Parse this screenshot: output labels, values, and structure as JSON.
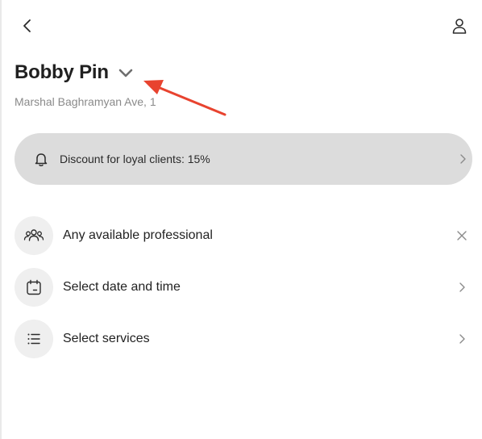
{
  "header": {
    "back_icon": "chevron-left-icon",
    "profile_icon": "user-icon"
  },
  "salon": {
    "name": "Bobby Pin",
    "address": "Marshal Baghramyan Ave, 1",
    "switch_icon": "chevron-down-icon"
  },
  "banner": {
    "icon": "bell-icon",
    "text": "Discount for loyal clients: 15%",
    "trail_icon": "chevron-right-icon"
  },
  "options": [
    {
      "label": "Any available professional",
      "icon": "people-icon",
      "trail_icon": "close-icon"
    },
    {
      "label": "Select date and time",
      "icon": "calendar-icon",
      "trail_icon": "chevron-right-icon"
    },
    {
      "label": "Select services",
      "icon": "list-icon",
      "trail_icon": "chevron-right-icon"
    }
  ],
  "colors": {
    "annotation_arrow": "#e8432f",
    "banner_bg": "#dcdcdc",
    "icon_circle_bg": "#efefef"
  }
}
